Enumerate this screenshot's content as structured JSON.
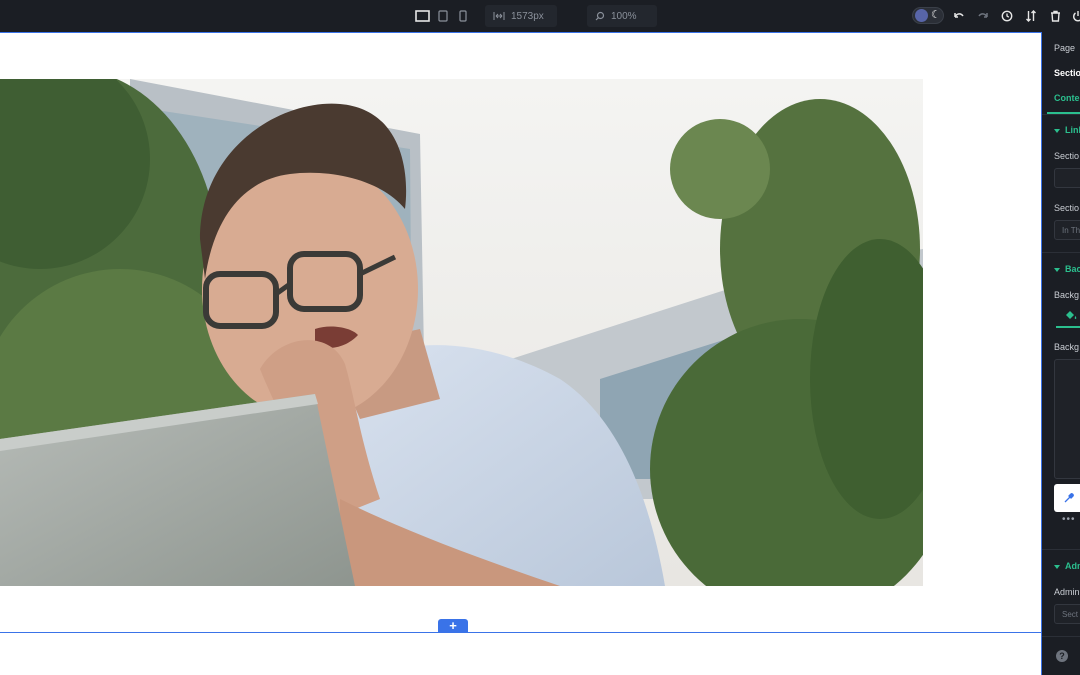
{
  "toolbar": {
    "width_value": "1573px",
    "zoom_value": "100%",
    "icons": [
      "desktop-icon",
      "tablet-icon",
      "mobile-icon",
      "width-icon",
      "zoom-icon",
      "undo-icon",
      "redo-icon",
      "history-icon",
      "sort-icon",
      "trash-icon",
      "power-icon"
    ]
  },
  "panel": {
    "breadcrumb": "Page",
    "element_title": "Sectio",
    "tab_content": "Conte",
    "group_link": "Link",
    "field_section_1": "Sectio",
    "field_section_2": "Sectio",
    "field_section_2_value": "In Th",
    "group_background": "Bac",
    "field_background_type": "Backg",
    "field_background": "Backg",
    "group_admin": "Adm",
    "field_admin": "Admin",
    "field_admin_placeholder": "Sect"
  },
  "colors": {
    "accent_blue": "#3a73e8",
    "accent_green": "#2bbf8e",
    "panel_bg": "#1b1e24"
  }
}
